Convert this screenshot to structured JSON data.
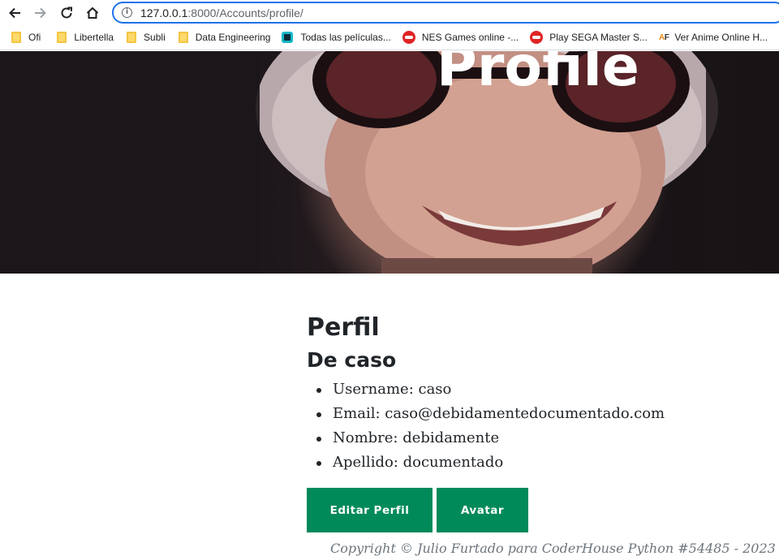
{
  "browser": {
    "url_host": "127.0.0.1",
    "url_path": ":8000/Accounts/profile/",
    "bookmarks": [
      {
        "label": "Ofi",
        "icon": "folder-icon"
      },
      {
        "label": "Libertella",
        "icon": "folder-icon"
      },
      {
        "label": "Subli",
        "icon": "folder-icon"
      },
      {
        "label": "Data Engineering",
        "icon": "folder-icon"
      },
      {
        "label": "Todas las películas...",
        "icon": "site-icon"
      },
      {
        "label": "NES Games online -...",
        "icon": "gamepad-icon"
      },
      {
        "label": "Play SEGA Master S...",
        "icon": "gamepad-icon"
      },
      {
        "label": "Ver Anime Online H...",
        "icon": "af-icon"
      }
    ]
  },
  "hero": {
    "title": "Profile"
  },
  "profile": {
    "heading": "Perfil",
    "subheading": "De caso",
    "fields": [
      "Username: caso",
      "Email: caso@debidamentedocumentado.com",
      "Nombre: debidamente",
      "Apellido: documentado"
    ],
    "edit_button": "Editar Perfil",
    "avatar_button": "Avatar"
  },
  "footer": {
    "text": "Copyright © Julio Furtado para CoderHouse Python #54485 - 2023"
  },
  "colors": {
    "button": "#008a5a",
    "omnibox_border": "#1a73e8"
  }
}
